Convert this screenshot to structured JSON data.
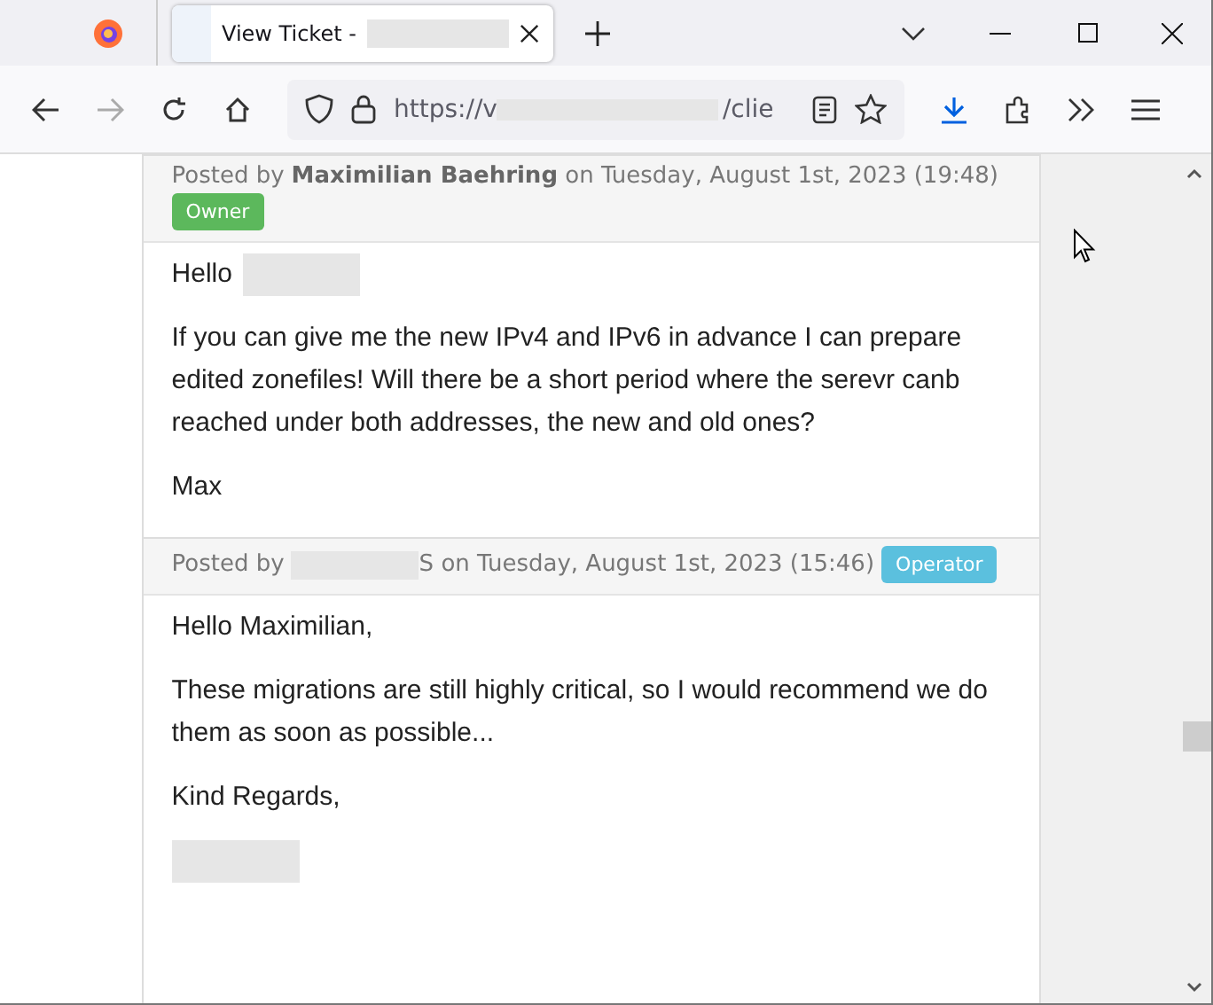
{
  "tab": {
    "title": "View Ticket -",
    "selected": true
  },
  "address": {
    "url": "https://v",
    "url_tail": "/clie"
  },
  "posts": [
    {
      "prefix": "Posted by",
      "author": "**Maximilian Baehring**",
      "author_redacted": false,
      "date": "on Tuesday, August 1st, 2023 (19:48)",
      "role": {
        "label": "Owner",
        "color": "#5cb85c"
      },
      "body": [
        {
          "kind": "text-redacted",
          "text": "Hello"
        },
        {
          "kind": "text",
          "text": "If you can give me the new IPv4 and IPv6 in advance I can prepare edited zonefiles! Will there be a short period where the serevr canb reached under both addresses, the new and old ones?"
        },
        {
          "kind": "text",
          "text": "Max"
        }
      ]
    },
    {
      "prefix": "Posted by",
      "author": "S",
      "author_redacted": true,
      "date": "on Tuesday, August 1st, 2023 (15:46)",
      "role": {
        "label": "Operator",
        "color": "#5bc0de"
      },
      "body": [
        {
          "kind": "text",
          "text": "Hello Maximilian,"
        },
        {
          "kind": "text",
          "text": "These migrations are still highly critical, so I would recommend we do them as soon as possible..."
        },
        {
          "kind": "text",
          "text": "Kind Regards,"
        },
        {
          "kind": "redacted"
        }
      ]
    }
  ]
}
